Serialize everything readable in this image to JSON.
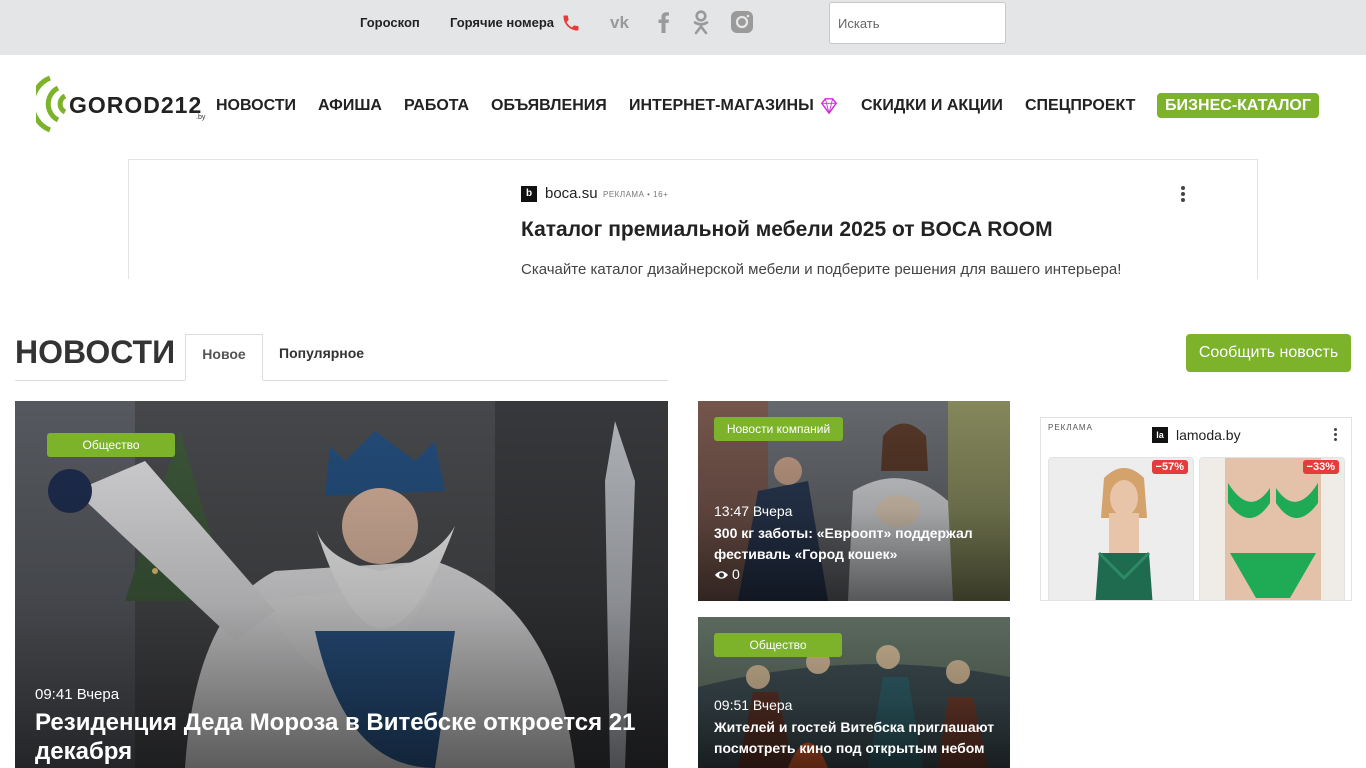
{
  "topbar": {
    "horoscope": "Гороскоп",
    "hotlines": "Горячие номера",
    "search_placeholder": "Искать",
    "socials": [
      "vk-icon",
      "facebook-icon",
      "odnoklassniki-icon",
      "instagram-icon"
    ]
  },
  "logo": {
    "text": "GOROD212",
    "suffix": ".by"
  },
  "nav": {
    "items": [
      "НОВОСТИ",
      "АФИША",
      "РАБОТА",
      "ОБЪЯВЛЕНИЯ",
      "ИНТЕРНЕТ-МАГАЗИНЫ",
      "СКИДКИ И АКЦИИ",
      "СПЕЦПРОЕКТ"
    ],
    "business_catalog": "БИЗНЕС-КАТАЛОГ"
  },
  "top_ad": {
    "favicon": "b",
    "domain": "boca.su",
    "mark": "РЕКЛАМА • 16+",
    "title": "Каталог премиальной мебели 2025 от BOCA ROOM",
    "description": "Скачайте каталог дизайнерской мебели и подберите решения для вашего интерьера!"
  },
  "news": {
    "heading": "НОВОСТИ",
    "tab_new": "Новое",
    "tab_popular": "Популярное",
    "report_button": "Сообщить новость",
    "items": [
      {
        "category": "Общество",
        "time": "09:41 Вчера",
        "title": "Резиденция Деда Мороза в Витебске откроется 21 декабря"
      },
      {
        "category": "Новости компаний",
        "time": "13:47 Вчера",
        "title": "300 кг заботы: «Евроопт» поддержал фестиваль «Город кошек»",
        "views": "0"
      },
      {
        "category": "Общество",
        "time": "09:51 Вчера",
        "title": "Жителей и гостей Витебска приглашают посмотреть кино под открытым небом"
      }
    ]
  },
  "side_ad": {
    "label": "РЕКЛАМА",
    "favicon": "la",
    "domain": "lamoda.by",
    "products": [
      {
        "discount": "−57%"
      },
      {
        "discount": "−33%"
      }
    ]
  },
  "colors": {
    "accent": "#7cb32b",
    "topbar_bg": "#e4e5e6",
    "discount": "#e53b3b",
    "phone": "#e53b3b",
    "diamond": "#d02ad9"
  }
}
